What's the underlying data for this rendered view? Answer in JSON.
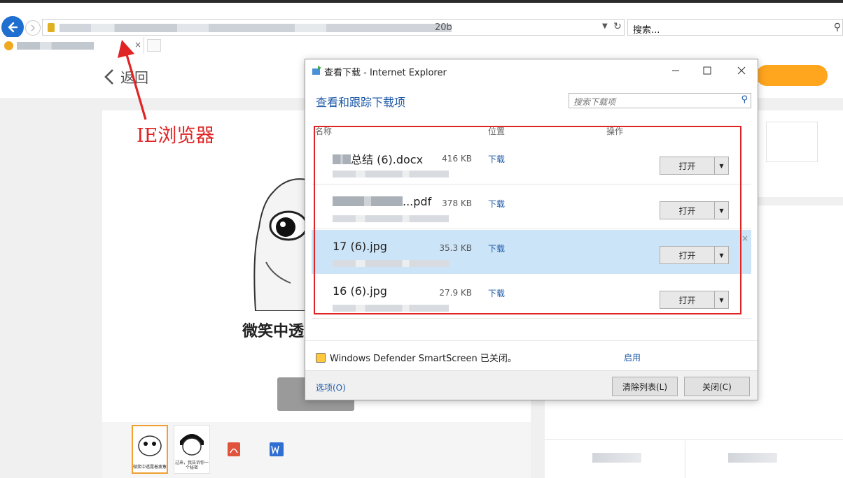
{
  "browser": {
    "url_tail": "20b",
    "search_placeholder": "搜索...",
    "tab_close": "×"
  },
  "page": {
    "back_label": "返回",
    "headline": "微笑中透",
    "thumb_captions": [
      "微笑中透露着疲惫",
      "过来，我告诉你一个秘密"
    ]
  },
  "annotation": {
    "text": "IE浏览器",
    "color": "#e02424"
  },
  "dialog": {
    "title": "查看下载 - Internet Explorer",
    "heading": "查看和跟踪下载项",
    "search_placeholder": "搜索下载项",
    "columns": {
      "name": "名称",
      "location": "位置",
      "actions": "操作"
    },
    "items": [
      {
        "name": "总结 (6).docx",
        "size": "416 KB",
        "location": "下载",
        "action": "打开"
      },
      {
        "name": "...pdf",
        "size": "378 KB",
        "location": "下载",
        "action": "打开"
      },
      {
        "name": "17 (6).jpg",
        "size": "35.3 KB",
        "location": "下载",
        "action": "打开"
      },
      {
        "name": "16 (6).jpg",
        "size": "27.9 KB",
        "location": "下载",
        "action": "打开"
      }
    ],
    "smartscreen_text": "Windows Defender SmartScreen 已关闭。",
    "enable_label": "启用",
    "options_label": "选项(O)",
    "clear_label": "清除列表(L)",
    "close_label": "关闭(C)",
    "remove_glyph": "×",
    "accent_color": "#1e5aa8",
    "selected_row_color": "#cce4f7"
  }
}
